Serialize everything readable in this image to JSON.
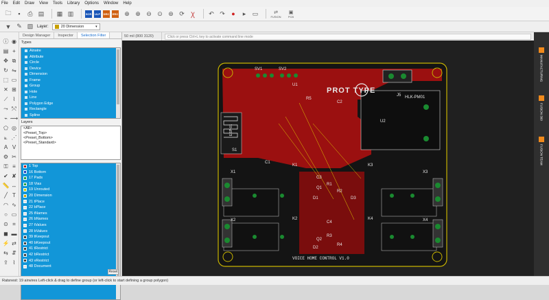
{
  "menu": [
    "File",
    "Edit",
    "Draw",
    "View",
    "Tools",
    "Library",
    "Options",
    "Window",
    "Help"
  ],
  "toolbar": {
    "layer_label": "Layer:",
    "layer_value": "20 Dimension",
    "badges": [
      "SCR",
      "ULP",
      "DRC",
      "ERC"
    ],
    "fusion_labels": [
      "FUSION",
      "PCB"
    ]
  },
  "tabs": [
    "Design Manager",
    "Inspector",
    "Selection Filter"
  ],
  "types_label": "Types",
  "types": [
    "Airwire",
    "Attribute",
    "Circle",
    "Device",
    "Dimension",
    "Frame",
    "Group",
    "Hole",
    "Line",
    "Polygon Edge",
    "Rectangle",
    "Spline"
  ],
  "layers_label": "Layers",
  "presets": [
    "<All>",
    "<Preset_Top>",
    "<Preset_Bottom>",
    "<Preset_Standard>"
  ],
  "layers": [
    {
      "name": "1 Top",
      "color": "#b22020"
    },
    {
      "name": "16 Bottom",
      "color": "#2040c0"
    },
    {
      "name": "17 Pads",
      "color": "#20a040"
    },
    {
      "name": "18 Vias",
      "color": "#20a040"
    },
    {
      "name": "19 Unrouted",
      "color": "#c8c800"
    },
    {
      "name": "20 Dimension",
      "color": "#c8a000"
    },
    {
      "name": "21 tPlace",
      "color": "#e0e0e0"
    },
    {
      "name": "22 bPlace",
      "color": "#e0e0e0"
    },
    {
      "name": "25 tNames",
      "color": "#e0e0e0"
    },
    {
      "name": "26 bNames",
      "color": "#e0e0e0"
    },
    {
      "name": "27 tValues",
      "color": "#e0e0e0"
    },
    {
      "name": "28 bValues",
      "color": "#e0e0e0"
    },
    {
      "name": "39 tKeepout",
      "color": "#404040"
    },
    {
      "name": "40 bKeepout",
      "color": "#404040"
    },
    {
      "name": "41 tRestrict",
      "color": "#404040"
    },
    {
      "name": "42 bRestrict",
      "color": "#404040"
    },
    {
      "name": "43 vRestrict",
      "color": "#404040"
    },
    {
      "name": "48 Document",
      "color": "#e0e0e0"
    }
  ],
  "reset_label": "Reset",
  "canvas": {
    "grid_info": "50 mil (800 3120)",
    "command_placeholder": "Click or press Ctrl+L key to activate command line mode"
  },
  "board": {
    "logo_text": "PROT    TYPE",
    "footer_text": "VOICE HOME CONTROL V1.0",
    "hlk_label": "HLK-PM01",
    "labels": [
      "U1",
      "U2",
      "J5",
      "X1",
      "X2",
      "X3",
      "X4",
      "K1",
      "K2",
      "K3",
      "K4",
      "C1",
      "C2",
      "C3",
      "C4",
      "R1",
      "R2",
      "R3",
      "R4",
      "R5",
      "D1",
      "D2",
      "D3",
      "Q1",
      "Q2",
      "SV1",
      "SV2",
      "S1",
      "ESP-01"
    ]
  },
  "right_panel": [
    "MANUFACTURING",
    "FUSION 360",
    "FUSION TEAM"
  ],
  "status": "Ratsnest: 19 airwires Left-click & drag to define group (or left-click to start defining a group polygon)"
}
